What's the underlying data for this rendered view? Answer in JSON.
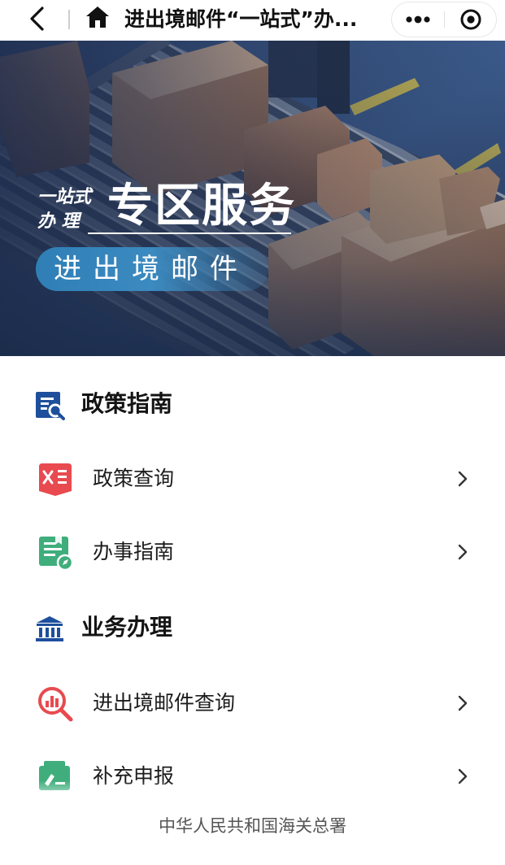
{
  "navbar": {
    "title": "进出境邮件“一站式”办...",
    "back_icon": "chevron-left-icon",
    "home_icon": "home-icon",
    "more_icon": "more-dots-icon",
    "close_icon": "target-close-icon"
  },
  "banner": {
    "small_line1": "一站式",
    "small_line2": "办 理",
    "headline": "专区服务",
    "subtitle": "进出境邮件"
  },
  "sections": [
    {
      "title": "政策指南",
      "icon": "policy-search-doc-icon",
      "items": [
        {
          "label": "政策查询",
          "icon": "policy-query-icon",
          "color": "#e84a4f"
        },
        {
          "label": "办事指南",
          "icon": "guide-compass-icon",
          "color": "#3fae7c"
        }
      ]
    },
    {
      "title": "业务办理",
      "icon": "bank-building-icon",
      "items": [
        {
          "label": "进出境邮件查询",
          "icon": "chart-magnifier-icon",
          "color": "#e84a4f"
        },
        {
          "label": "补充申报",
          "icon": "supplement-declare-icon",
          "color": "#3fae7c"
        }
      ]
    }
  ],
  "footer": {
    "text": "中华人民共和国海关总署"
  },
  "colors": {
    "brand_blue": "#1e4f9c",
    "red": "#e84a4f",
    "green": "#3fae7c"
  }
}
